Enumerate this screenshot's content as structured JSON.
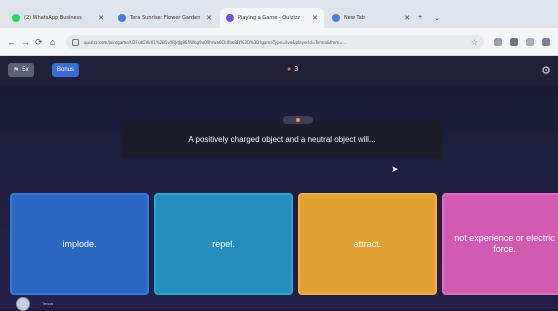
{
  "browser": {
    "tabs": [
      {
        "title": "(2) WhatsApp Business",
        "favicon_color": "#25d366"
      },
      {
        "title": "Tera Sunrise: Flower Garden",
        "favicon_color": "#4a7dd8"
      },
      {
        "title": "Playing a Game - Quizizz",
        "favicon_color": "#7b4fd6"
      },
      {
        "title": "New Tab",
        "favicon_color": "#4a7dd8"
      }
    ],
    "url": "quizizz.com/join/game/U2FsdGVkX1%2B5vYRJdJg9E5Wbg9u0iIhrwa6CkXtw8Ff%3D%3D?gameType=live&playerId=Tenna&from=..."
  },
  "quiz": {
    "powerup_label": "5x",
    "bonus_label": "Bonus",
    "streak_count": "3",
    "question": "A positively charged object and a neutral object will...",
    "answers": [
      {
        "label": "implode."
      },
      {
        "label": "repel."
      },
      {
        "label": "attract."
      },
      {
        "label": "not experience or electric force."
      }
    ],
    "player_name": "Tenna"
  }
}
